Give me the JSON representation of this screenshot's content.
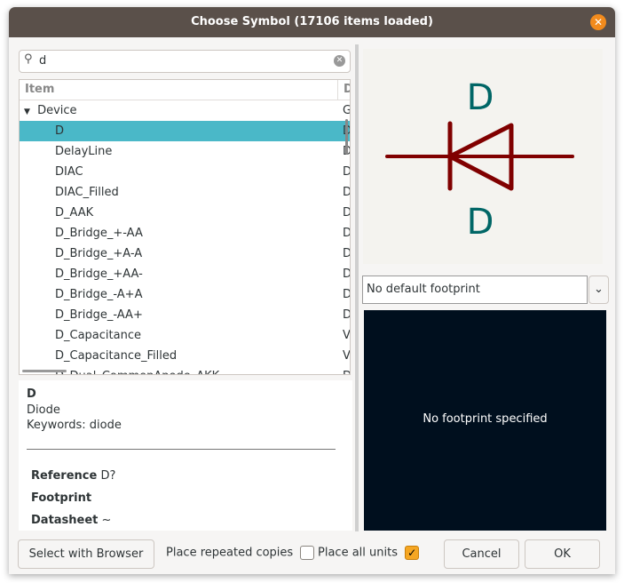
{
  "title": "Choose Symbol (17106 items loaded)",
  "search": {
    "value": "d"
  },
  "tree": {
    "headers": [
      "Item",
      "D"
    ],
    "group": {
      "name": "Device",
      "desc": "G"
    },
    "rows": [
      {
        "name": "D",
        "desc": "D"
      },
      {
        "name": "DelayLine",
        "desc": "D"
      },
      {
        "name": "DIAC",
        "desc": "D"
      },
      {
        "name": "DIAC_Filled",
        "desc": "D"
      },
      {
        "name": "D_AAK",
        "desc": "D"
      },
      {
        "name": "D_Bridge_+-AA",
        "desc": "D"
      },
      {
        "name": "D_Bridge_+A-A",
        "desc": "D"
      },
      {
        "name": "D_Bridge_+AA-",
        "desc": "D"
      },
      {
        "name": "D_Bridge_-A+A",
        "desc": "D"
      },
      {
        "name": "D_Bridge_-AA+",
        "desc": "D"
      },
      {
        "name": "D_Capacitance",
        "desc": "V"
      },
      {
        "name": "D_Capacitance_Filled",
        "desc": "V"
      },
      {
        "name": "D_Dual_CommonAnode_AKK",
        "desc": "D"
      }
    ]
  },
  "info": {
    "name": "D",
    "description": "Diode",
    "keywords": "Keywords: diode",
    "fields": [
      {
        "label": "Reference",
        "value": "D?"
      },
      {
        "label": "Footprint",
        "value": ""
      },
      {
        "label": "Datasheet",
        "value": "~"
      }
    ]
  },
  "preview": {
    "ref": "D",
    "value": "D"
  },
  "footprint_select": "No default footprint",
  "footprint_preview": "No footprint specified",
  "buttons": {
    "browser": "Select with Browser",
    "repeated": "Place repeated copies",
    "all_units": "Place all units",
    "cancel": "Cancel",
    "ok": "OK"
  },
  "checks": {
    "repeated": false,
    "all_units": true
  }
}
